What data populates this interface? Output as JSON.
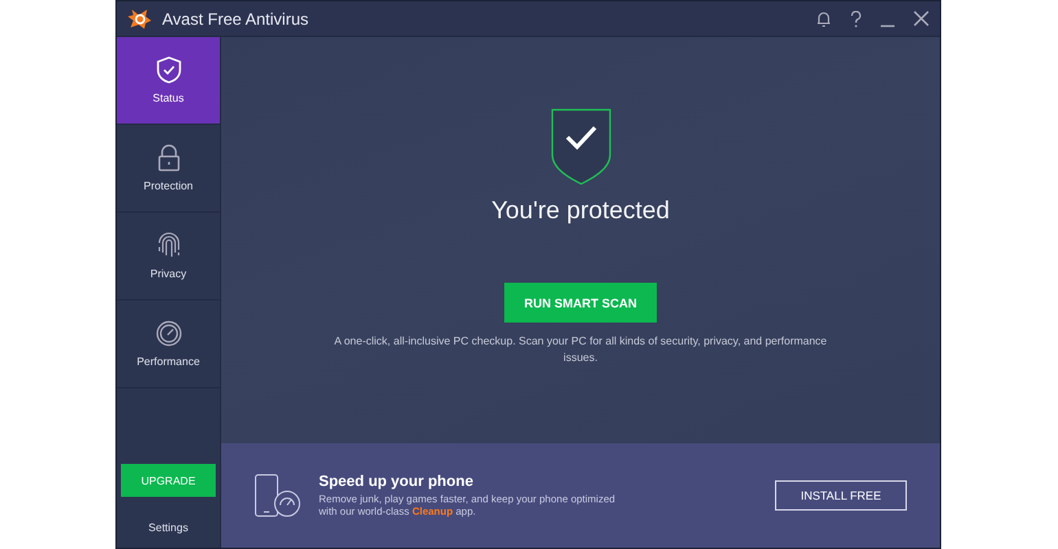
{
  "window": {
    "title": "Avast Free Antivirus"
  },
  "sidebar": {
    "items": [
      {
        "kind": "shield",
        "label": "Status",
        "selected": true
      },
      {
        "kind": "lock",
        "label": "Protection",
        "selected": false
      },
      {
        "kind": "fingerprint",
        "label": "Privacy",
        "selected": false
      },
      {
        "kind": "gauge",
        "label": "Performance",
        "selected": false
      }
    ],
    "upgrade_button": "UPGRADE",
    "settings": "Settings"
  },
  "status": {
    "headline": "You're protected",
    "scan_button": "RUN SMART SCAN",
    "description": "A one-click, all-inclusive PC checkup. Scan your PC for all kinds of security, privacy, and performance issues."
  },
  "promo": {
    "title": "Speed up your phone",
    "text": "Remove junk, play games faster, and keep your phone optimized with our world-class **Cleanup** app.",
    "button": "INSTALL FREE"
  }
}
